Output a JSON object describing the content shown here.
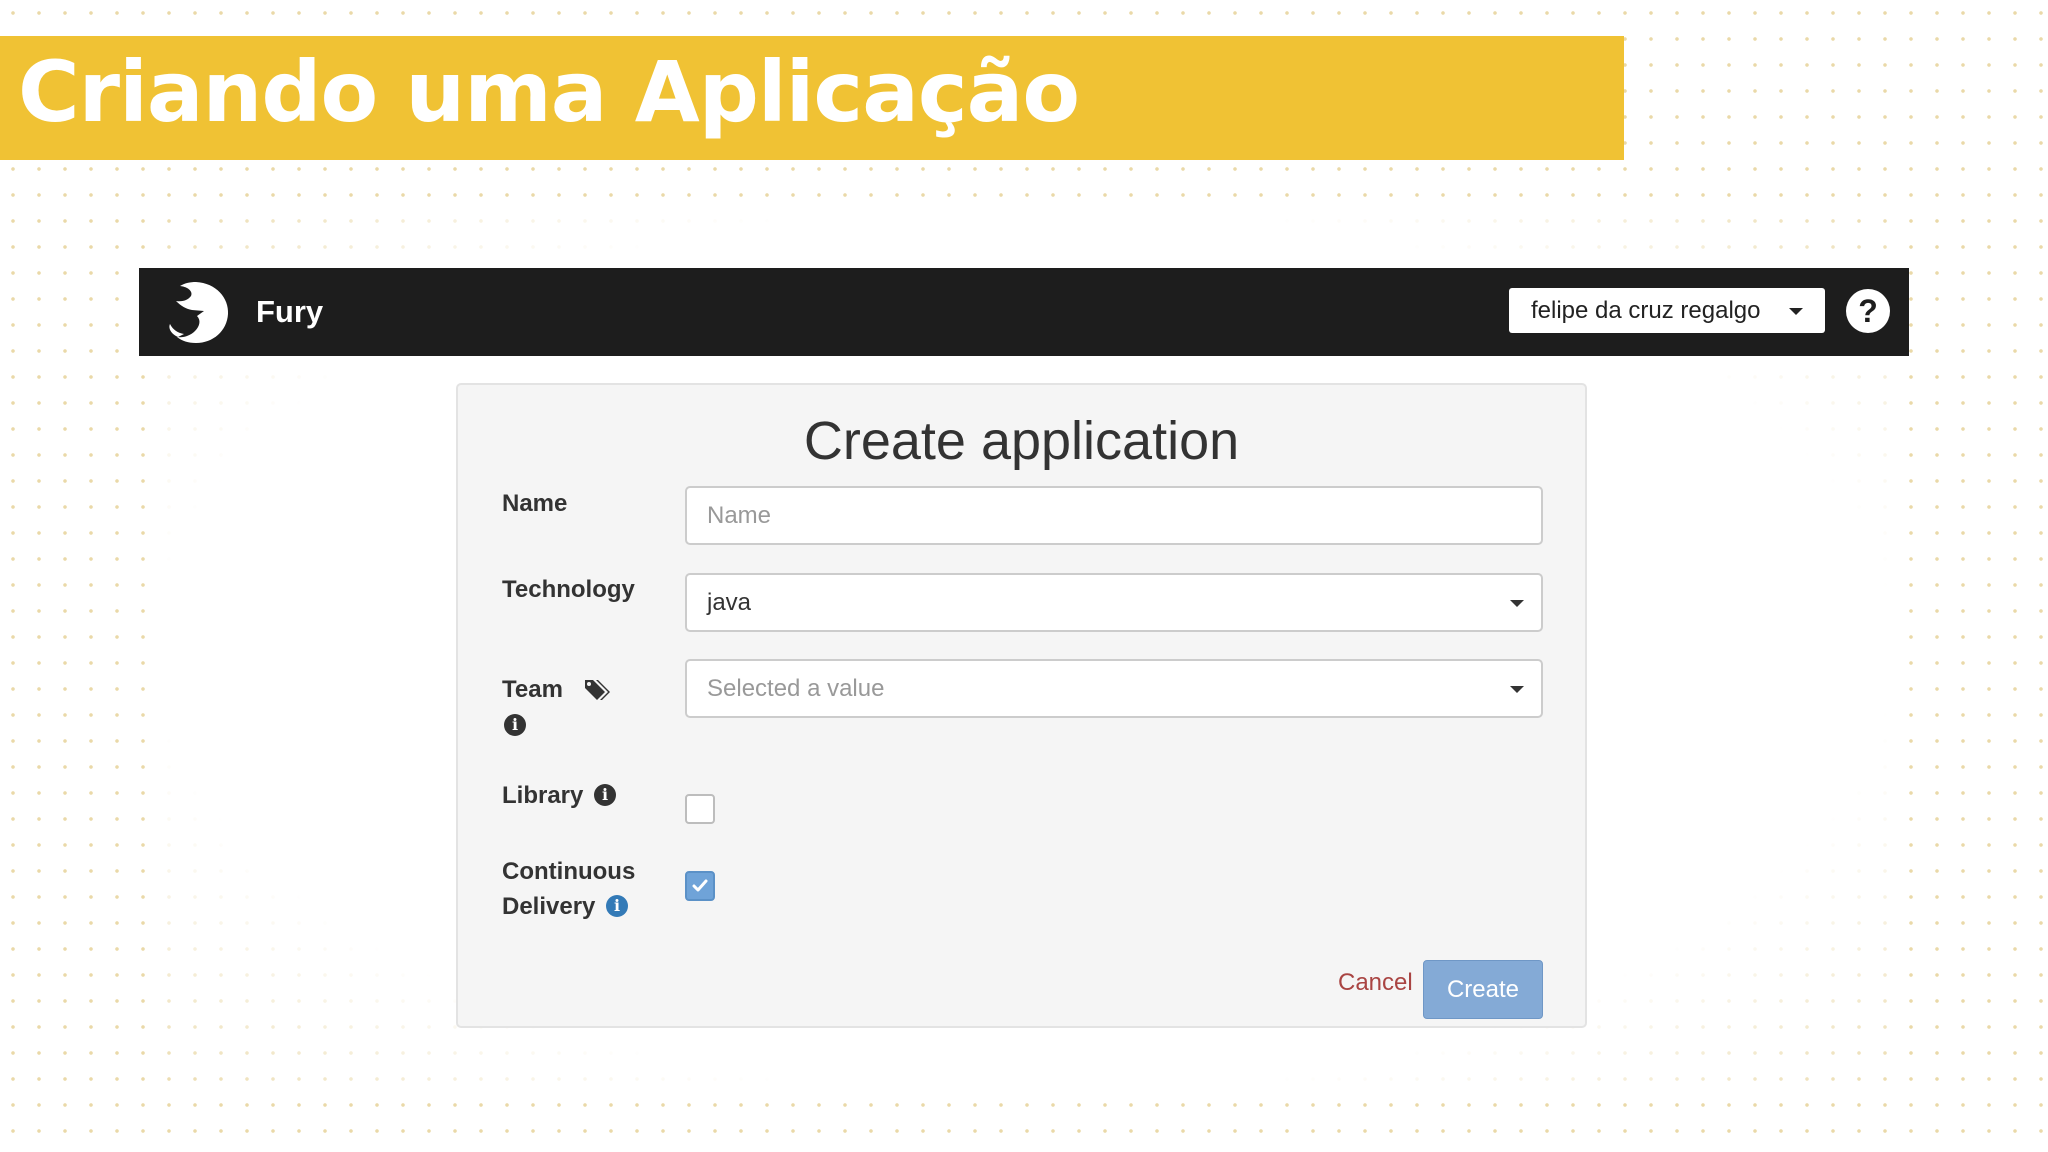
{
  "slide": {
    "title": "Criando uma Aplicação"
  },
  "app": {
    "brand": "Fury",
    "user_menu": {
      "label": "felipe da cruz regalgo"
    },
    "help_icon": "?"
  },
  "form": {
    "title": "Create application",
    "name": {
      "label": "Name",
      "placeholder": "Name"
    },
    "technology": {
      "label": "Technology",
      "value": "java"
    },
    "team": {
      "label": "Team",
      "placeholder": "Selected a value"
    },
    "library": {
      "label": "Library",
      "checked": false
    },
    "continuous_delivery": {
      "label_line1": "Continuous",
      "label_line2": "Delivery",
      "checked": true
    },
    "info_icon": "i",
    "cancel_label": "Cancel",
    "create_label": "Create"
  },
  "colors": {
    "banner": "#f0c234",
    "topbar": "#1d1d1d",
    "primary_button": "#84aad6",
    "cancel_link": "#a94442",
    "info_blue": "#337ab7"
  },
  "icons": {
    "logo": "fury-logo-icon",
    "user_menu_caret": "chevron-down-icon",
    "help": "question-circle-icon",
    "team_tags": "tags-icon",
    "info": "info-circle-icon",
    "checkbox_check": "checkmark-icon"
  }
}
